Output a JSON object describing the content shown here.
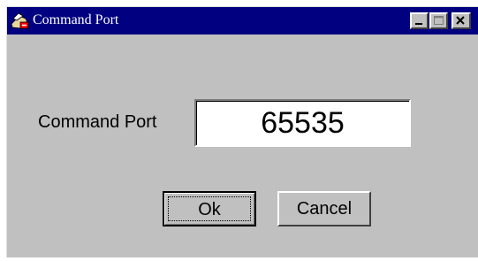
{
  "window": {
    "title": "Command Port",
    "controls": [
      "minimize",
      "maximize",
      "close"
    ]
  },
  "form": {
    "port_label": "Command Port",
    "port_value": "65535"
  },
  "buttons": {
    "ok_label": "Ok",
    "cancel_label": "Cancel"
  },
  "colors": {
    "titlebar": "#000080",
    "face": "#c0c0c0"
  }
}
